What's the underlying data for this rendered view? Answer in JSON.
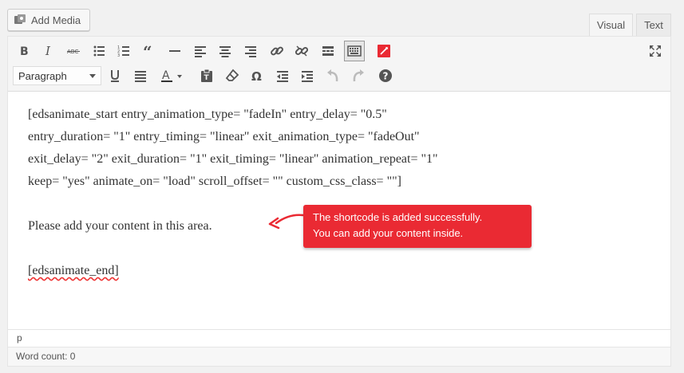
{
  "header": {
    "add_media_label": "Add Media",
    "tabs": [
      {
        "label": "Visual",
        "active": true
      },
      {
        "label": "Text",
        "active": false
      }
    ]
  },
  "toolbar": {
    "row1": [
      "bold-icon",
      "italic-icon",
      "strikethrough-icon",
      "bulleted-list-icon",
      "numbered-list-icon",
      "blockquote-icon",
      "horizontal-line-icon",
      "align-left-icon",
      "align-center-icon",
      "align-right-icon",
      "link-icon",
      "unlink-icon",
      "read-more-icon",
      "toolbar-toggle-icon",
      "animate-shortcode-icon"
    ],
    "row2": [
      "underline-icon",
      "justify-icon",
      "text-color-icon",
      "paste-as-text-icon",
      "clear-formatting-icon",
      "special-character-icon",
      "decrease-indent-icon",
      "increase-indent-icon",
      "undo-icon",
      "redo-icon",
      "help-icon"
    ],
    "format_value": "Paragraph",
    "fullscreen_icon": "fullscreen-icon",
    "accent": "#ea2a33"
  },
  "content": {
    "shortcode_lines": [
      "[edsanimate_start entry_animation_type= \"fadeIn\" entry_delay= \"0.5\"",
      "entry_duration= \"1\" entry_timing= \"linear\" exit_animation_type= \"fadeOut\"",
      "exit_delay= \"2\" exit_duration= \"1\" exit_timing= \"linear\" animation_repeat= \"1\"",
      "keep= \"yes\" animate_on= \"load\" scroll_offset= \"\" custom_css_class= \"\"]"
    ],
    "placeholder_text": "Please add your content in this area.",
    "end_tag": "[edsanimate_end]"
  },
  "callout": {
    "line1": "The shortcode is added successfully.",
    "line2": "You can add your content inside.",
    "color": "#ea2a33"
  },
  "status": {
    "path": "p",
    "word_count": "Word count: 0"
  }
}
